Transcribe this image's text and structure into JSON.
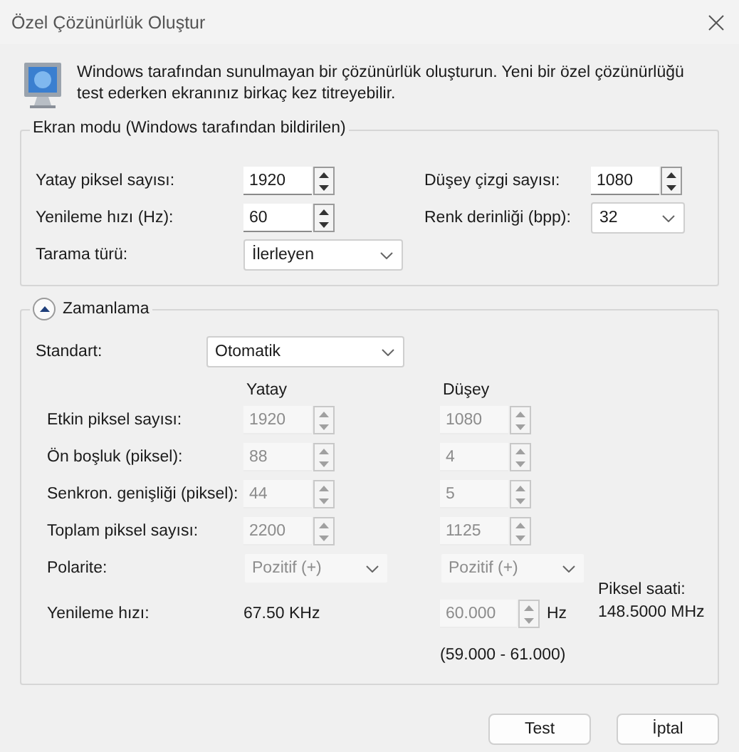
{
  "window": {
    "title": "Özel Çözünürlük Oluştur"
  },
  "intro": "Windows tarafından sunulmayan bir çözünürlük oluşturun. Yeni bir özel çözünürlüğü test ederken ekranınız birkaç kez titreyebilir.",
  "display_mode": {
    "legend": "Ekran modu (Windows tarafından bildirilen)",
    "fields": [
      {
        "label": "Yatay piksel sayısı:",
        "kind": "spinner",
        "value": "1920"
      },
      {
        "label": "Düşey çizgi sayısı:",
        "kind": "spinner",
        "value": "1080"
      },
      {
        "label": "Yenileme hızı (Hz):",
        "kind": "spinner",
        "value": "60"
      },
      {
        "label": "Renk derinliği (bpp):",
        "kind": "dropdown",
        "value": "32"
      },
      {
        "label": "Tarama türü:",
        "kind": "dropdown",
        "value": "İlerleyen"
      }
    ]
  },
  "timing": {
    "title": "Zamanlama",
    "expanded": true,
    "standard": {
      "label": "Standart:",
      "value": "Otomatik"
    },
    "column_headings": [
      "Yatay",
      "Düşey"
    ],
    "rows": [
      {
        "label": "Etkin piksel sayısı:",
        "horizontal": {
          "kind": "spinner",
          "value": "1920",
          "disabled": true
        },
        "vertical": {
          "kind": "spinner",
          "value": "1080",
          "disabled": true
        }
      },
      {
        "label": "Ön boşluk (piksel):",
        "horizontal": {
          "kind": "spinner",
          "value": "88",
          "disabled": true
        },
        "vertical": {
          "kind": "spinner",
          "value": "4",
          "disabled": true
        }
      },
      {
        "label": "Senkron. genişliği (piksel):",
        "horizontal": {
          "kind": "spinner",
          "value": "44",
          "disabled": true
        },
        "vertical": {
          "kind": "spinner",
          "value": "5",
          "disabled": true
        }
      },
      {
        "label": "Toplam piksel sayısı:",
        "horizontal": {
          "kind": "spinner",
          "value": "2200",
          "disabled": true
        },
        "vertical": {
          "kind": "spinner",
          "value": "1125",
          "disabled": true
        }
      },
      {
        "label": "Polarite:",
        "horizontal": {
          "kind": "dropdown",
          "value": "Pozitif (+)",
          "disabled": true
        },
        "vertical": {
          "kind": "dropdown",
          "value": "Pozitif (+)",
          "disabled": true
        }
      }
    ],
    "refresh": {
      "label": "Yenileme hızı:",
      "horizontal_value": "67.50 KHz",
      "vertical": {
        "kind": "spinner",
        "value": "60.000",
        "disabled": true
      },
      "unit": "Hz",
      "range": "(59.000 - 61.000)"
    },
    "pixel_clock": {
      "label": "Piksel saati:",
      "value": "148.5000 MHz"
    }
  },
  "buttons": [
    "Test",
    "İptal"
  ]
}
